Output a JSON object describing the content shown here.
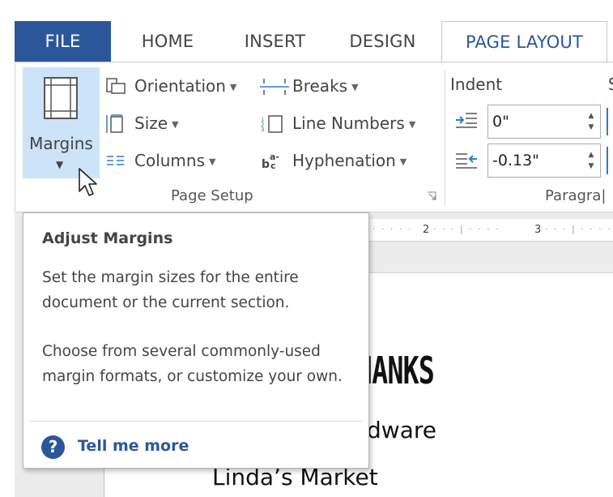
{
  "tabs": {
    "file": "FILE",
    "home": "HOME",
    "insert": "INSERT",
    "design": "DESIGN",
    "page_layout": "PAGE LAYOUT"
  },
  "ribbon": {
    "margins_label": "Margins",
    "page_setup": {
      "orientation": "Orientation",
      "size": "Size",
      "columns": "Columns",
      "breaks": "Breaks",
      "line_numbers": "Line Numbers",
      "hyphenation": "Hyphenation",
      "group_label": "Page Setup"
    },
    "paragraph": {
      "indent_title": "Indent",
      "spacing_title_partial": "S",
      "left_indent": "0\"",
      "right_indent": "-0.13\"",
      "group_label_partial": "Paragra|"
    }
  },
  "ruler": {
    "marks": [
      "2",
      "3"
    ]
  },
  "document": {
    "title_partial": "HANKS",
    "line1_partial": "rdware",
    "line2": "Linda’s Market"
  },
  "tooltip": {
    "title": "Adjust Margins",
    "body1": "Set the margin sizes for the entire document or the current section.",
    "body2": "Choose from several commonly-used margin formats, or customize your own.",
    "help_link": "Tell me more"
  },
  "colors": {
    "accent": "#2b579a",
    "selected_button_bg": "#cde3f7"
  }
}
